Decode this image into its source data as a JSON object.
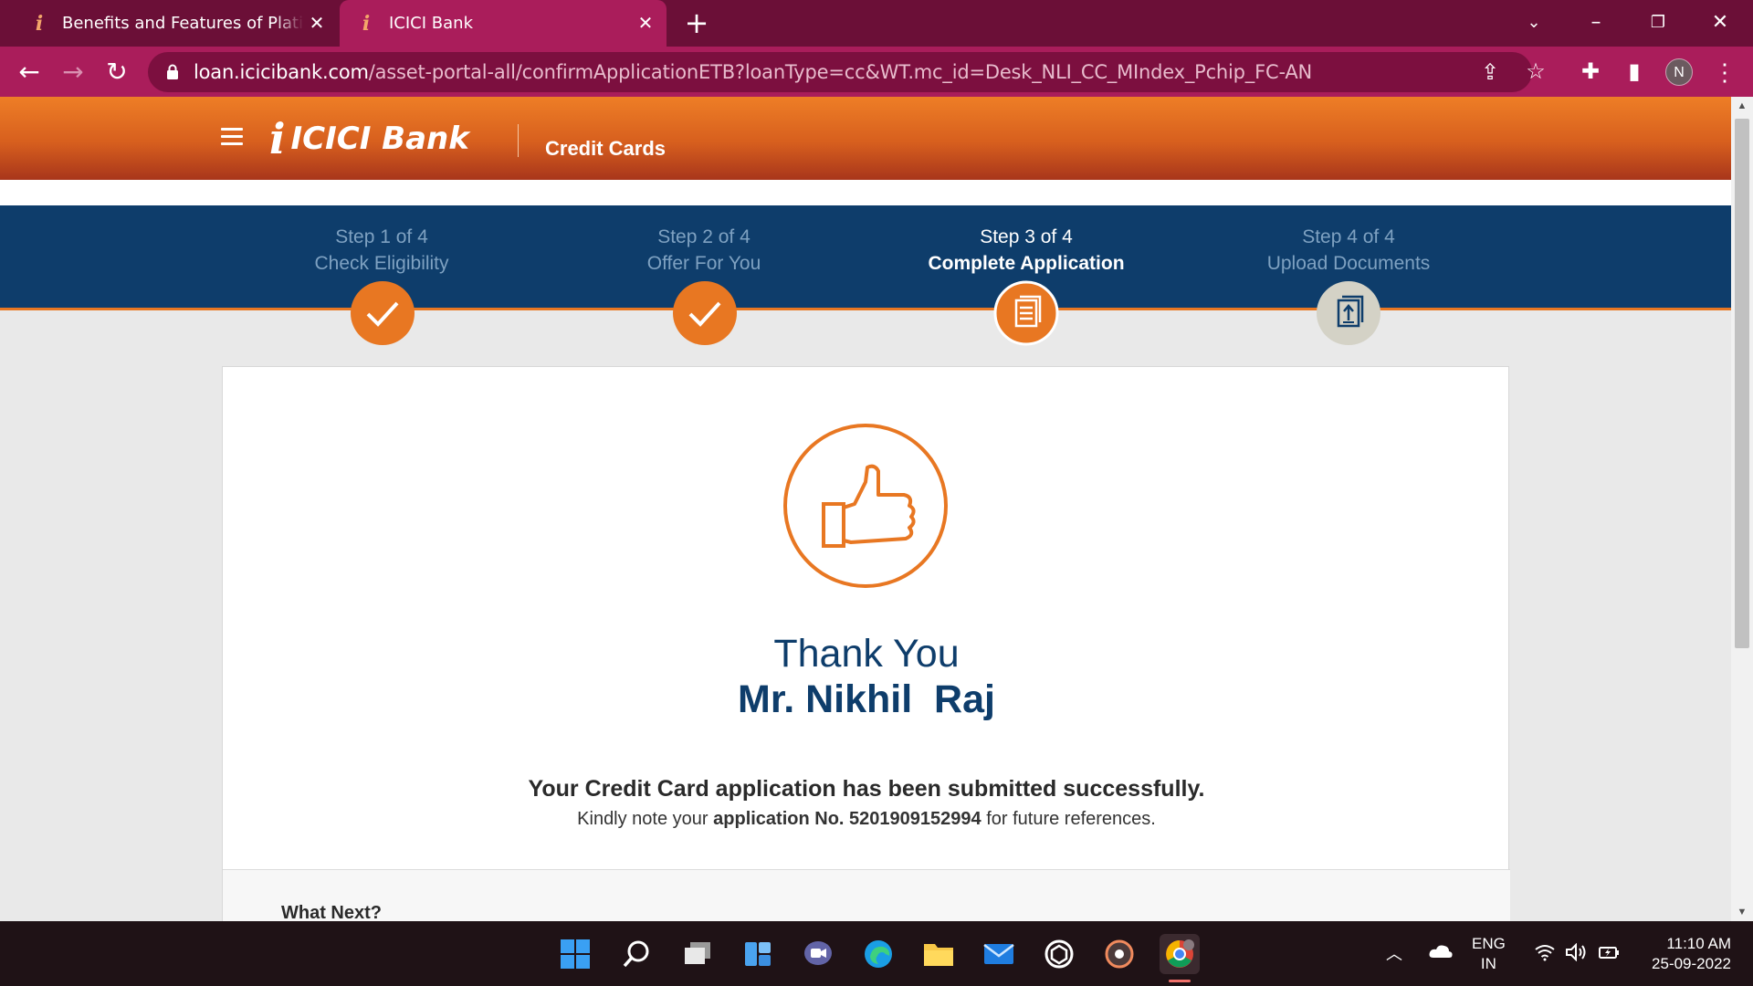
{
  "browser": {
    "tabs": [
      {
        "title": "Benefits and Features of Platinum",
        "active": false
      },
      {
        "title": "ICICI Bank",
        "active": true
      }
    ],
    "url_host": "loan.icicibank.com",
    "url_path": "/asset-portal-all/confirmApplicationETB?loanType=cc&WT.mc_id=Desk_NLI_CC_MIndex_Pchip_FC-AN",
    "profile_initial": "N"
  },
  "site": {
    "logo_text": "ICICI Bank",
    "section_title": "Credit Cards"
  },
  "steps": [
    {
      "step": "Step 1 of 4",
      "label": "Check Eligibility",
      "state": "done",
      "icon": "check-icon"
    },
    {
      "step": "Step 2 of 4",
      "label": "Offer For You",
      "state": "done",
      "icon": "check-icon"
    },
    {
      "step": "Step 3 of 4",
      "label": "Complete Application",
      "state": "current",
      "icon": "document-icon"
    },
    {
      "step": "Step 4 of 4",
      "label": "Upload Documents",
      "state": "todo",
      "icon": "upload-document-icon"
    }
  ],
  "confirmation": {
    "thank_you": "Thank You",
    "name": "Mr. Nikhil  Raj",
    "success_message": "Your Credit Card application has been submitted successfully.",
    "note_prefix": "Kindly note your ",
    "app_no_label": "application No. 5201909152994",
    "note_suffix": " for future references.",
    "what_next": "What Next?"
  },
  "taskbar": {
    "lang_1": "ENG",
    "lang_2": "IN",
    "time": "11:10 AM",
    "date": "25-09-2022"
  },
  "colors": {
    "brand_orange": "#e87722",
    "brand_navy": "#0e3d6b",
    "browser_tab_bar": "#6b0f37",
    "browser_toolbar": "#aa1d5b"
  }
}
